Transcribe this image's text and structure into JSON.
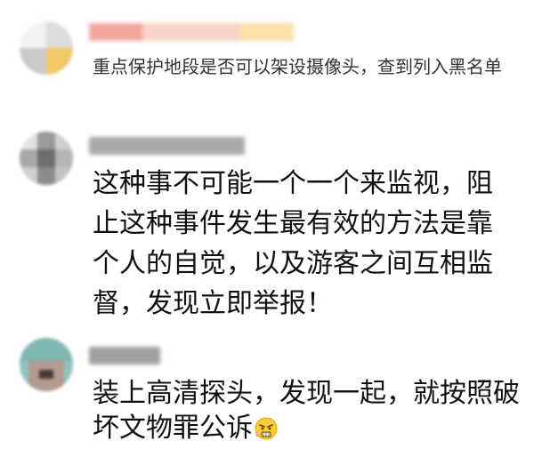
{
  "comments": [
    {
      "avatar": "blurred-avatar",
      "username": "",
      "text": "重点保护地段是否可以架设摄像头，查到列入黑名单"
    },
    {
      "avatar": "blurred-avatar",
      "username": "",
      "text": "这种事不可能一个一个来监视，阻止这种事件发生最有效的方法是靠个人的自觉，以及游客之间互相监督，发现立即举报！"
    },
    {
      "avatar": "blurred-avatar",
      "username": "",
      "text": "装上高清探头，发现一起，就按照破坏文物罪公诉",
      "emoji": "angry-face-emoji"
    }
  ]
}
